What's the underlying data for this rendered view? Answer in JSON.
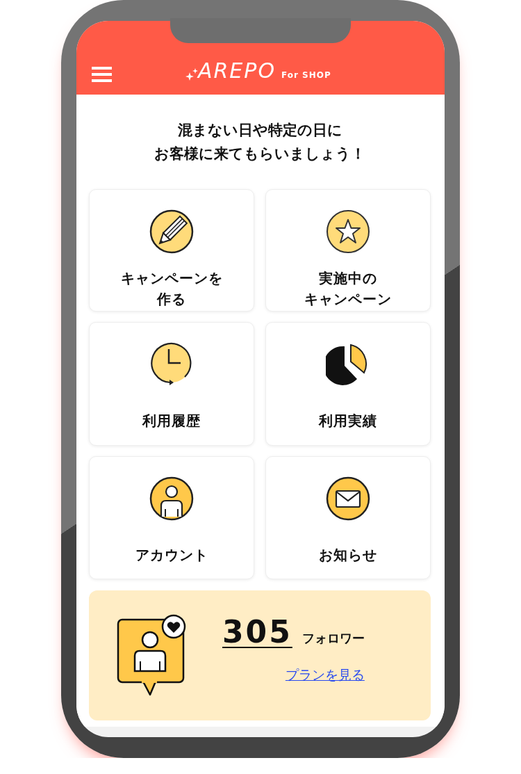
{
  "header": {
    "logo": "AREPO",
    "logo_suffix": "For SHOP"
  },
  "headline": [
    "混まない日や特定の日に",
    "お客様に来てもらいましょう！"
  ],
  "menu": [
    {
      "label": [
        "キャンペーンを",
        "作る"
      ]
    },
    {
      "label": [
        "実施中の",
        "キャンペーン"
      ]
    },
    {
      "label": [
        "利用履歴"
      ]
    },
    {
      "label": [
        "利用実績"
      ]
    },
    {
      "label": [
        "アカウント"
      ]
    },
    {
      "label": [
        "お知らせ"
      ]
    }
  ],
  "followers": {
    "count": "305",
    "label": "フォロワー",
    "link": "プランを見る"
  }
}
